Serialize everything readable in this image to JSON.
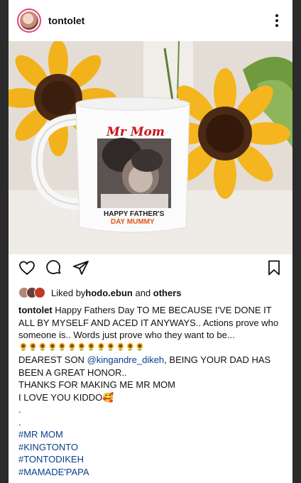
{
  "post": {
    "username": "tontolet",
    "mug_title": "Mr Mom",
    "mug_text_line1": "HAPPY FATHER'S",
    "mug_text_line2": "DAY MUMMY"
  },
  "likes": {
    "prefix": "Liked by ",
    "user": "hodo.ebun",
    "middle": " and ",
    "others": "others"
  },
  "caption": {
    "username": "tontolet",
    "line1": "Happy Fathers Day TO ME BECAUSE I'VE DONE IT ALL BY MYSELF AND ACED IT ANYWAYS.. Actions prove who someone is.. Words just prove who they want to be...",
    "sunflowers": "🌻🌻🌻🌻🌻🌻🌻🌻🌻🌻🌻🌻🌻",
    "dear_prefix": "DEAREST SON ",
    "mention": "@kingandre_dikeh",
    "dear_suffix": ", BEING YOUR DAD HAS BEEN A GREAT HONOR..",
    "thanks": "THANKS FOR MAKING ME MR MOM",
    "love": "I LOVE YOU KIDDO🥰",
    "dot1": ".",
    "dot2": ".",
    "tags": [
      "#MR MOM",
      "#KINGTONTO",
      "#TONTODIKEH",
      "#MAMADE'PAPA"
    ]
  },
  "icons": [
    "heart-icon",
    "comment-icon",
    "share-icon",
    "bookmark-icon",
    "more-icon"
  ]
}
